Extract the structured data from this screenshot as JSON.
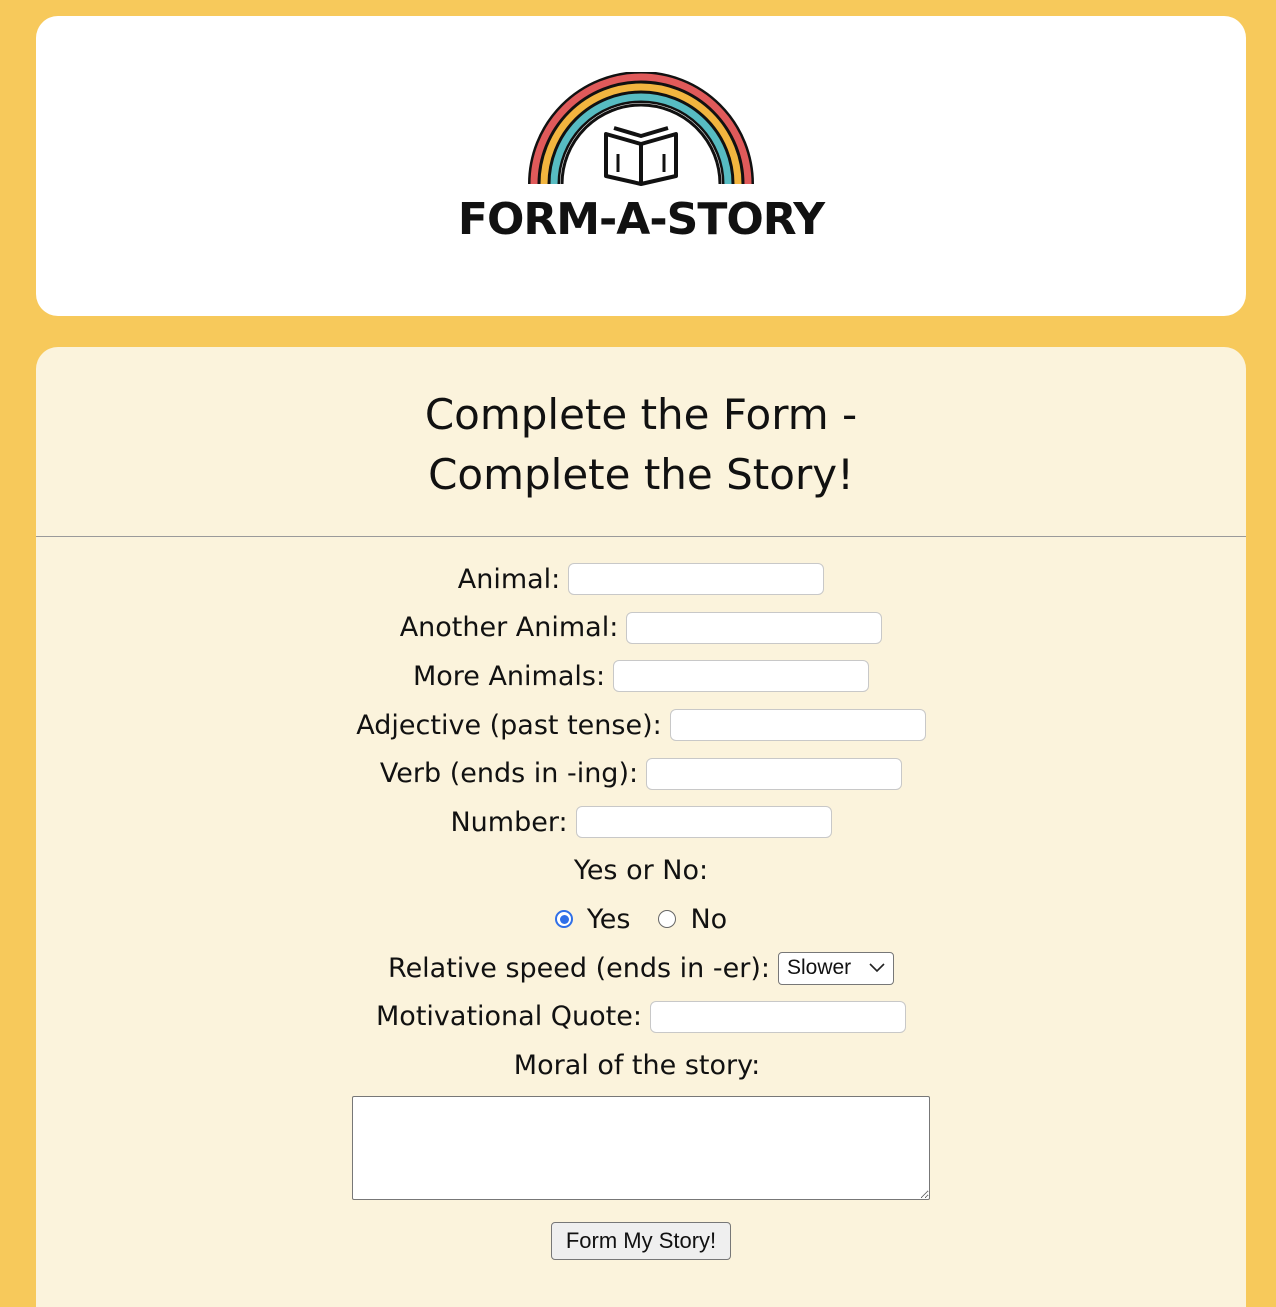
{
  "logo": {
    "text": "FORM-A-STORY",
    "colors": {
      "red": "#e05a5a",
      "yellow": "#f2b53f",
      "teal": "#57bcc2"
    }
  },
  "form": {
    "title_line1": "Complete the Form -",
    "title_line2": "Complete the Story!",
    "fields": {
      "animal": {
        "label": "Animal:",
        "value": ""
      },
      "another_animal": {
        "label": "Another Animal:",
        "value": ""
      },
      "more_animals": {
        "label": "More Animals:",
        "value": ""
      },
      "adjective": {
        "label": "Adjective (past tense):",
        "value": ""
      },
      "verb": {
        "label": "Verb (ends in -ing):",
        "value": ""
      },
      "number": {
        "label": "Number:",
        "value": ""
      },
      "yes_no": {
        "label": "Yes or No:",
        "options": [
          "Yes",
          "No"
        ],
        "selected": "Yes"
      },
      "speed": {
        "label": "Relative speed (ends in -er):",
        "selected": "Slower"
      },
      "quote": {
        "label": "Motivational Quote:",
        "value": ""
      },
      "moral": {
        "label": "Moral of the story:",
        "value": ""
      }
    },
    "submit_label": "Form My Story!"
  }
}
